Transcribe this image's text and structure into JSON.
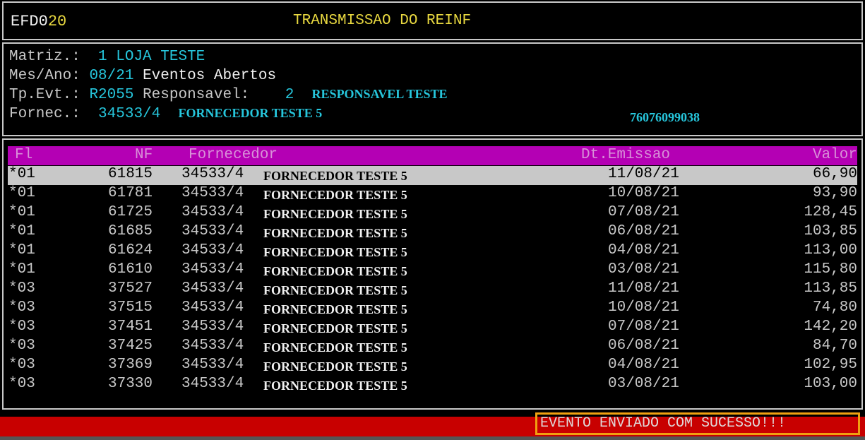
{
  "title": {
    "code_prefix": "EFD0",
    "code_suffix": "20",
    "text": "TRANSMISSAO DO REINF"
  },
  "header": {
    "matriz_label": "Matriz.:",
    "matriz_value": "1 LOJA TESTE",
    "mesano_label": "Mes/Ano:",
    "mesano_value": "08/21",
    "mesano_status": "Eventos Abertos",
    "tpevt_label": "Tp.Evt.:",
    "tpevt_value": "R2055",
    "responsavel_label": "Responsavel:",
    "responsavel_code": "2",
    "responsavel_name": "RESPONSAVEL TESTE",
    "fornec_label": "Fornec.:",
    "fornec_code": "34533/4",
    "fornec_name": "FORNECEDOR TESTE 5",
    "fornec_doc": "76076099038"
  },
  "table": {
    "columns": {
      "fl": "Fl",
      "nf": "NF",
      "fornecedor": "Fornecedor",
      "dt_emissao": "Dt.Emissao",
      "valor": "Valor"
    },
    "rows": [
      {
        "fl": "*01",
        "nf": "61815",
        "forn_code": "34533/4",
        "forn_name": "FORNECEDOR TESTE 5",
        "date": "11/08/21",
        "valor": "66,90"
      },
      {
        "fl": "*01",
        "nf": "61781",
        "forn_code": "34533/4",
        "forn_name": "FORNECEDOR TESTE 5",
        "date": "10/08/21",
        "valor": "93,90"
      },
      {
        "fl": "*01",
        "nf": "61725",
        "forn_code": "34533/4",
        "forn_name": "FORNECEDOR TESTE 5",
        "date": "07/08/21",
        "valor": "128,45"
      },
      {
        "fl": "*01",
        "nf": "61685",
        "forn_code": "34533/4",
        "forn_name": "FORNECEDOR TESTE 5",
        "date": "06/08/21",
        "valor": "103,85"
      },
      {
        "fl": "*01",
        "nf": "61624",
        "forn_code": "34533/4",
        "forn_name": "FORNECEDOR TESTE 5",
        "date": "04/08/21",
        "valor": "113,00"
      },
      {
        "fl": "*01",
        "nf": "61610",
        "forn_code": "34533/4",
        "forn_name": "FORNECEDOR TESTE 5",
        "date": "03/08/21",
        "valor": "115,80"
      },
      {
        "fl": "*03",
        "nf": "37527",
        "forn_code": "34533/4",
        "forn_name": "FORNECEDOR TESTE 5",
        "date": "11/08/21",
        "valor": "113,85"
      },
      {
        "fl": "*03",
        "nf": "37515",
        "forn_code": "34533/4",
        "forn_name": "FORNECEDOR TESTE 5",
        "date": "10/08/21",
        "valor": "74,80"
      },
      {
        "fl": "*03",
        "nf": "37451",
        "forn_code": "34533/4",
        "forn_name": "FORNECEDOR TESTE 5",
        "date": "07/08/21",
        "valor": "142,20"
      },
      {
        "fl": "*03",
        "nf": "37425",
        "forn_code": "34533/4",
        "forn_name": "FORNECEDOR TESTE 5",
        "date": "06/08/21",
        "valor": "84,70"
      },
      {
        "fl": "*03",
        "nf": "37369",
        "forn_code": "34533/4",
        "forn_name": "FORNECEDOR TESTE 5",
        "date": "04/08/21",
        "valor": "102,95"
      },
      {
        "fl": "*03",
        "nf": "37330",
        "forn_code": "34533/4",
        "forn_name": "FORNECEDOR TESTE 5",
        "date": "03/08/21",
        "valor": "103,00"
      }
    ]
  },
  "status": {
    "message": "EVENTO ENVIADO COM SUCESSO!!!"
  }
}
